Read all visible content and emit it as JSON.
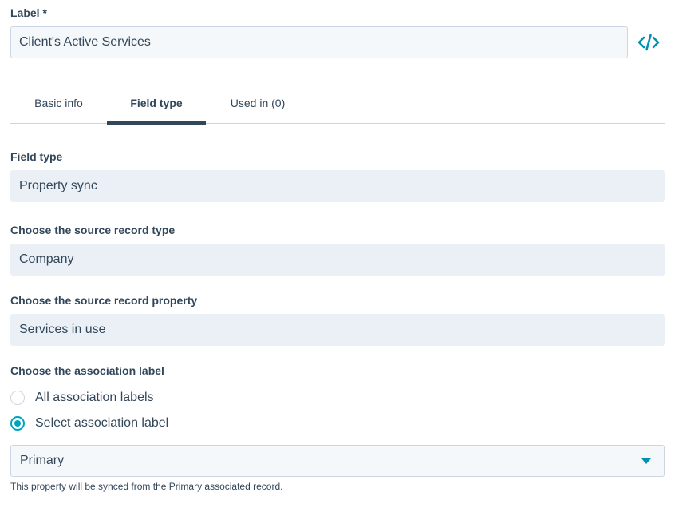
{
  "label_field": {
    "title": "Label *",
    "value": "Client's Active Services"
  },
  "tabs": [
    {
      "label": "Basic info",
      "active": false
    },
    {
      "label": "Field type",
      "active": true
    },
    {
      "label": "Used in (0)",
      "active": false
    }
  ],
  "field_type": {
    "label": "Field type",
    "value": "Property sync"
  },
  "source_record_type": {
    "label": "Choose the source record type",
    "value": "Company"
  },
  "source_record_property": {
    "label": "Choose the source record property",
    "value": "Services in use"
  },
  "association": {
    "label": "Choose the association label",
    "options": [
      {
        "label": "All association labels",
        "checked": false
      },
      {
        "label": "Select association label",
        "checked": true
      }
    ],
    "selected": "Primary",
    "help": "This property will be synced from the Primary associated record."
  },
  "icons": {
    "code": "code-icon",
    "dropdown": "chevron-down-icon"
  },
  "colors": {
    "accent": "#0091ae",
    "radio_active": "#00a4bd",
    "text": "#33475b",
    "readonly_bg": "#eaf0f6"
  }
}
